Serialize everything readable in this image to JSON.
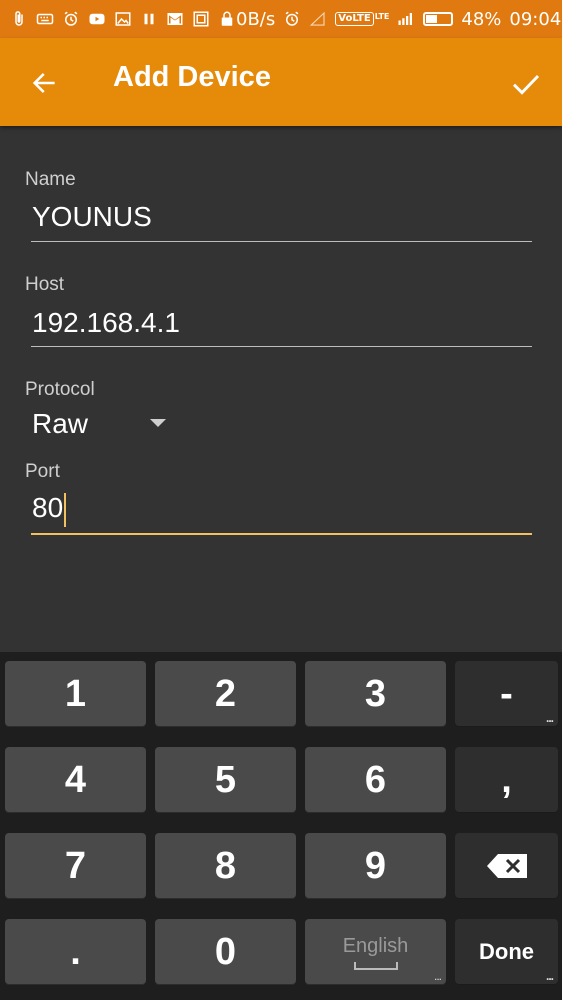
{
  "status_bar": {
    "network_speed": "0B/s",
    "volte": "VoLTE",
    "lte": "LTE",
    "battery_percent": "48%",
    "battery_level": 0.48,
    "time": "09:04"
  },
  "app_bar": {
    "title": "Add Device",
    "back_icon": "arrow-left-icon",
    "confirm_icon": "check-icon"
  },
  "form": {
    "name": {
      "label": "Name",
      "value": "YOUNUS"
    },
    "host": {
      "label": "Host",
      "value": "192.168.4.1"
    },
    "protocol": {
      "label": "Protocol",
      "value": "Raw"
    },
    "port": {
      "label": "Port",
      "value": "80"
    }
  },
  "keyboard": {
    "keys": [
      "1",
      "2",
      "3",
      "-",
      "4",
      "5",
      "6",
      ",",
      "7",
      "8",
      "9",
      ".",
      "0"
    ],
    "language_key": "English",
    "done_key": "Done",
    "more_indicator": "..."
  },
  "colors": {
    "status_bar": "#E07A10",
    "app_bar": "#E68A0A",
    "background": "#333333",
    "accent": "#F3C061"
  }
}
